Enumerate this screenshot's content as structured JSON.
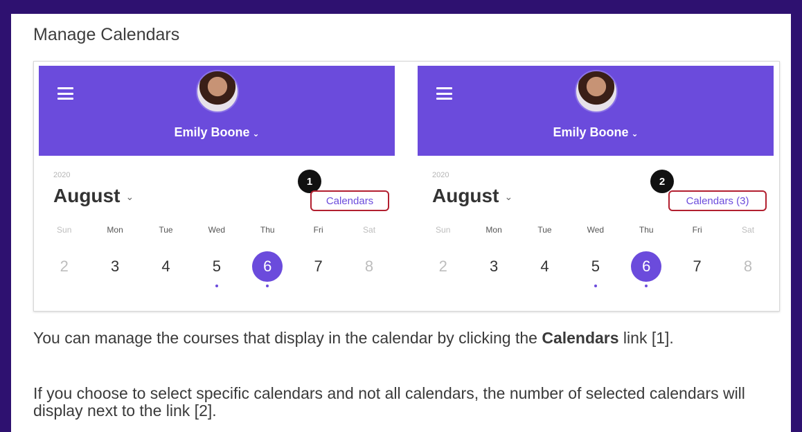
{
  "page": {
    "title": "Manage Calendars"
  },
  "panels": [
    {
      "user_name": "Emily Boone",
      "year": "2020",
      "month": "August",
      "calendars_link": "Calendars",
      "callout": "1",
      "weekdays": [
        "Sun",
        "Mon",
        "Tue",
        "Wed",
        "Thu",
        "Fri",
        "Sat"
      ],
      "days": [
        "2",
        "3",
        "4",
        "5",
        "6",
        "7",
        "8"
      ]
    },
    {
      "user_name": "Emily Boone",
      "year": "2020",
      "month": "August",
      "calendars_link": "Calendars (3)",
      "callout": "2",
      "weekdays": [
        "Sun",
        "Mon",
        "Tue",
        "Wed",
        "Thu",
        "Fri",
        "Sat"
      ],
      "days": [
        "2",
        "3",
        "4",
        "5",
        "6",
        "7",
        "8"
      ]
    }
  ],
  "caption1": {
    "before": "You can manage the courses that display in the calendar by clicking the ",
    "bold": "Calendars",
    "after": " link [1]."
  },
  "caption2": "If you choose to select specific calendars and not all calendars, the number of selected calendars will display next to the link [2].",
  "icons": {
    "menu": "hamburger-menu-icon",
    "dropdown": "chevron-down-icon",
    "avatar": "user-avatar"
  },
  "colors": {
    "background": "#2e1170",
    "header": "#6b4bdc",
    "highlight": "#b21f2f"
  }
}
